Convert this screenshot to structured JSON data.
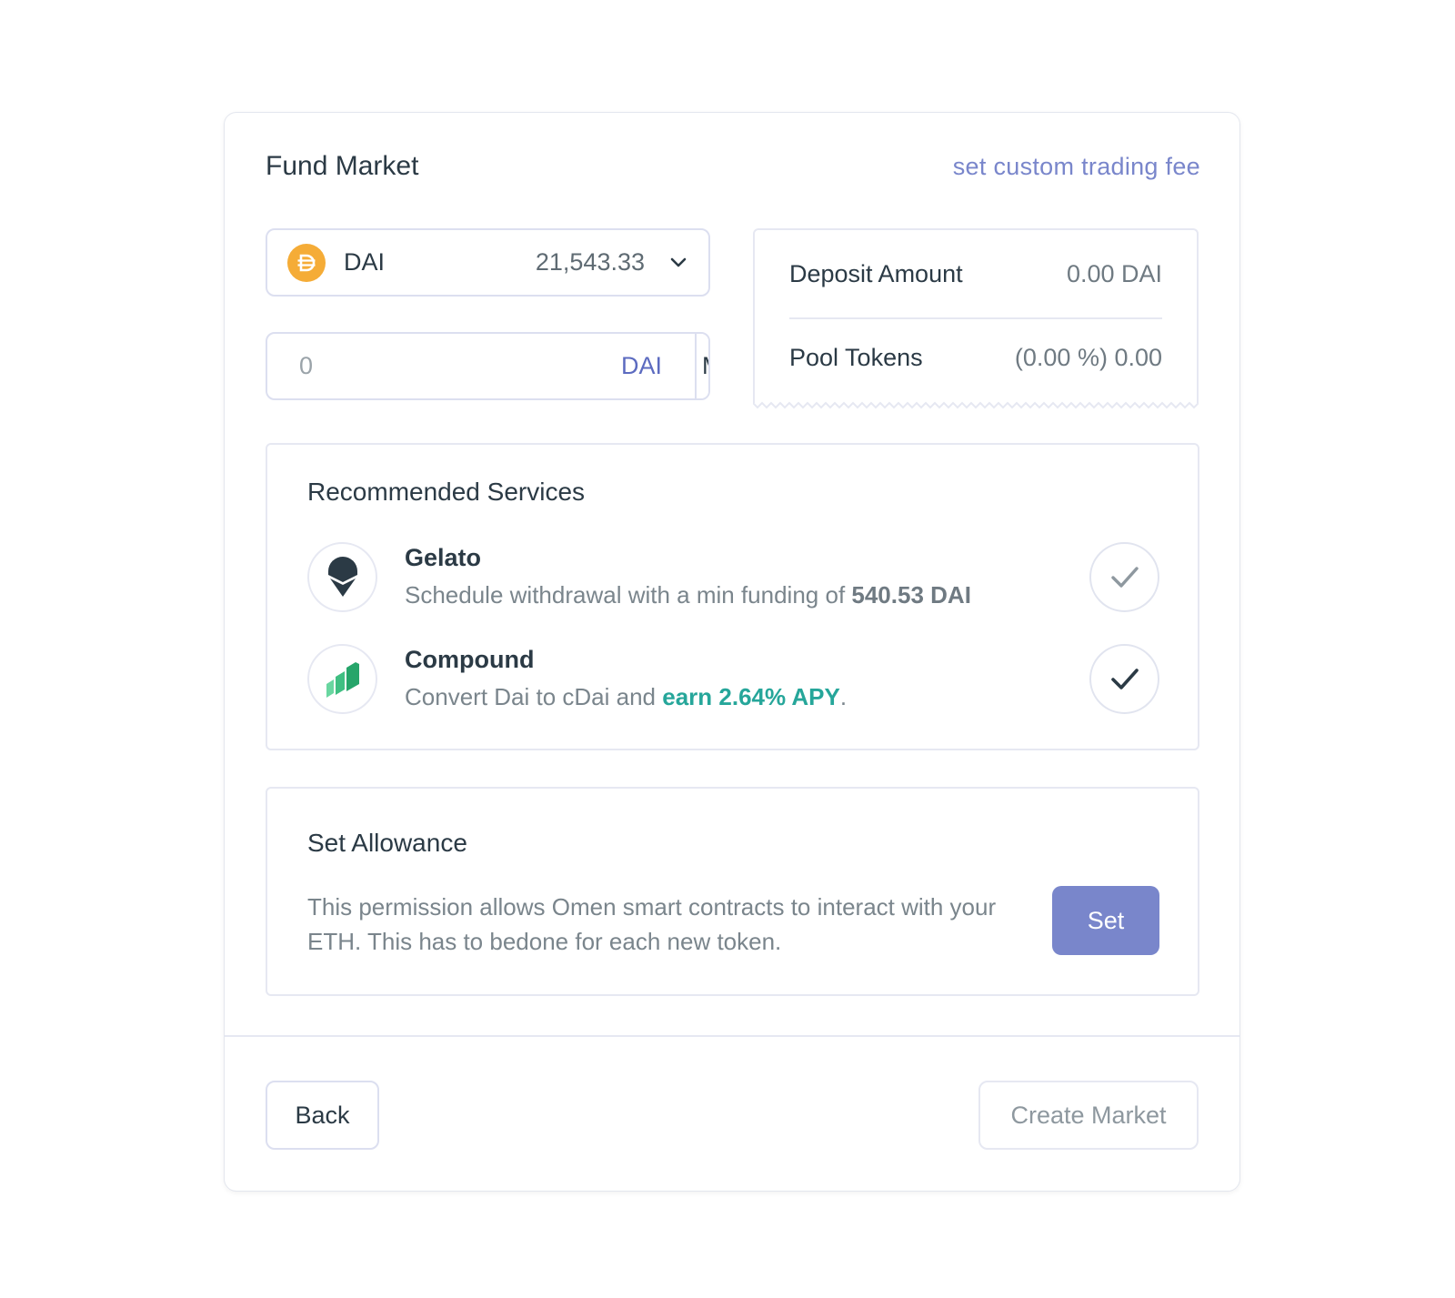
{
  "header": {
    "title": "Fund Market",
    "custom_fee_link": "set custom trading fee"
  },
  "currency": {
    "symbol": "DAI",
    "balance": "21,543.33",
    "icon": "dai-icon"
  },
  "amount": {
    "value": "",
    "placeholder": "0",
    "unit": "DAI",
    "max_label": "Max"
  },
  "summary": {
    "rows": [
      {
        "label": "Deposit Amount",
        "value": "0.00 DAI"
      },
      {
        "label": "Pool Tokens",
        "value": "(0.00 %) 0.00"
      }
    ]
  },
  "services": {
    "title": "Recommended Services",
    "items": [
      {
        "name": "Gelato",
        "icon": "gelato-icon",
        "desc_prefix": "Schedule withdrawal with a min funding of ",
        "desc_highlight": "540.53 DAI",
        "desc_suffix": "",
        "checked": false
      },
      {
        "name": "Compound",
        "icon": "compound-icon",
        "desc_prefix": "Convert Dai to cDai and ",
        "desc_highlight": "earn 2.64% APY",
        "desc_suffix": ".",
        "checked": true
      }
    ]
  },
  "allowance": {
    "title": "Set Allowance",
    "description": "This permission allows Omen smart contracts to interact with your ETH. This has to bedone for each new token.",
    "button_label": "Set"
  },
  "footer": {
    "back_label": "Back",
    "create_label": "Create Market"
  },
  "colors": {
    "accent": "#7986cb",
    "dai": "#f5ac37",
    "compound": "#26a69a"
  }
}
